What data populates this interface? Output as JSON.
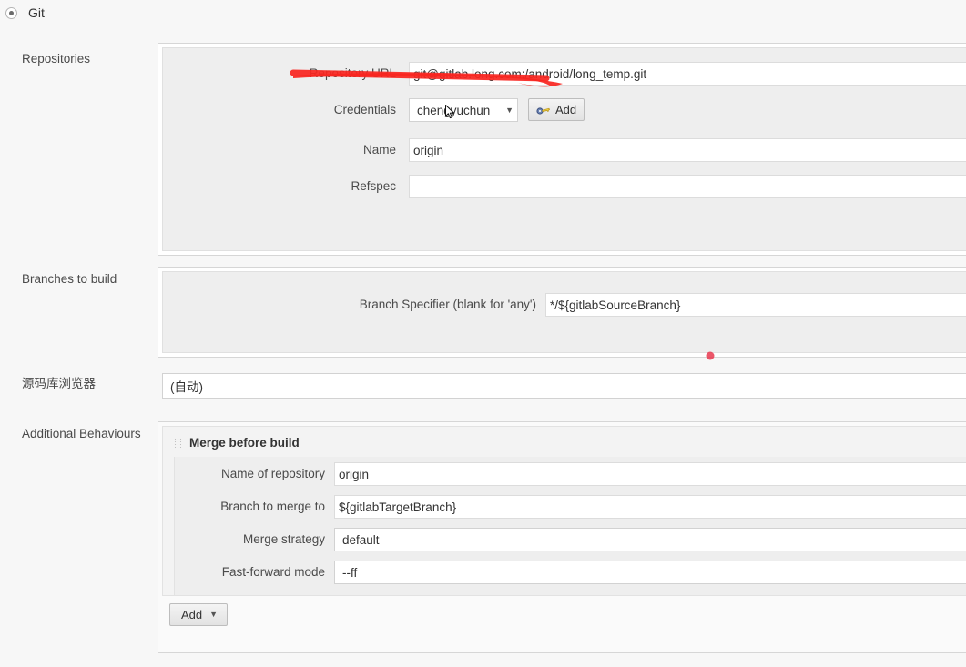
{
  "scm": {
    "selected_label": "Git",
    "radio_checked": true
  },
  "sections": {
    "repositories_label": "Repositories",
    "branches_label": "Branches to build",
    "browser_label": "源码库浏览器",
    "behaviours_label": "Additional Behaviours"
  },
  "repository": {
    "url_label": "Repository URL",
    "url_value": "git@gitlab.long.com:/android/long_temp.git",
    "credentials_label": "Credentials",
    "credentials_value": "chengyuchun",
    "credentials_caret": "▼",
    "add_credentials_label": "Add",
    "add_credentials_icon": "key-icon",
    "name_label": "Name",
    "name_value": "origin",
    "refspec_label": "Refspec",
    "refspec_value": ""
  },
  "branches": {
    "specifier_label": "Branch Specifier (blank for 'any')",
    "specifier_value": "*/${gitlabSourceBranch}"
  },
  "browser": {
    "value": "(自动)",
    "caret": "▼"
  },
  "behaviour": {
    "title": "Merge before build",
    "drag_handle_icon": "drag-handle-icon",
    "repo_name_label": "Name of repository",
    "repo_name_value": "origin",
    "merge_branch_label": "Branch to merge to",
    "merge_branch_value": "${gitlabTargetBranch}",
    "merge_strategy_label": "Merge strategy",
    "merge_strategy_value": "default",
    "merge_strategy_caret": "▼",
    "fast_forward_label": "Fast-forward mode",
    "fast_forward_value": "--ff",
    "fast_forward_caret": "▼",
    "add_label": "Add",
    "add_caret": "▼"
  },
  "annotations": {
    "strikethrough_color": "#f8251f",
    "dot_color": "#e8384f"
  }
}
